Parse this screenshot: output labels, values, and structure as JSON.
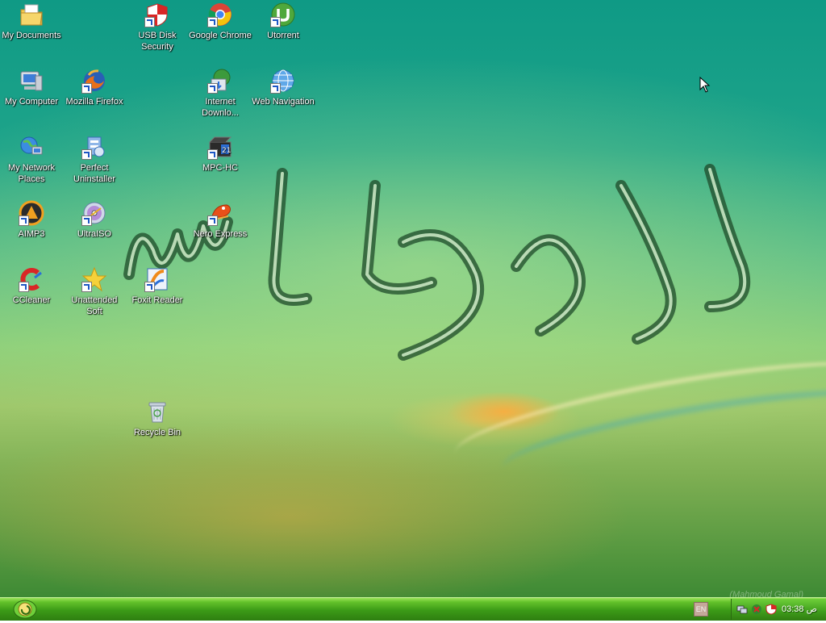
{
  "desktop_icons": [
    {
      "label": "My Documents",
      "icon": "my-documents-icon"
    },
    {
      "label": "My Computer",
      "icon": "my-computer-icon"
    },
    {
      "label": "My Network Places",
      "icon": "my-network-places-icon"
    },
    {
      "label": "AIMP3",
      "icon": "aimp3-icon"
    },
    {
      "label": "CCleaner",
      "icon": "ccleaner-icon"
    },
    {
      "label": "Mozilla Firefox",
      "icon": "firefox-icon"
    },
    {
      "label": "Perfect Uninstaller",
      "icon": "perfect-uninstaller-icon"
    },
    {
      "label": "UltraISO",
      "icon": "ultraiso-icon"
    },
    {
      "label": "Unattended Soft",
      "icon": "unattended-soft-icon"
    },
    {
      "label": "USB Disk Security",
      "icon": "usb-disk-security-icon"
    },
    {
      "label": "Foxit Reader",
      "icon": "foxit-reader-icon"
    },
    {
      "label": "Recycle Bin",
      "icon": "recycle-bin-icon"
    },
    {
      "label": "Google Chrome",
      "icon": "chrome-icon"
    },
    {
      "label": "Internet Downlo...",
      "icon": "internet-download-manager-icon"
    },
    {
      "label": "MPC-HC",
      "icon": "mpc-hc-icon"
    },
    {
      "label": "Nero Express",
      "icon": "nero-express-icon"
    },
    {
      "label": "Utorrent",
      "icon": "utorrent-icon"
    },
    {
      "label": "Web Navigation",
      "icon": "web-navigation-icon"
    }
  ],
  "wallpaper": {
    "watermark": "(Mahmoud Gamal)"
  },
  "taskbar": {
    "language": "EN",
    "clock": "03:38 ص"
  },
  "colors": {
    "taskbar_green": "#3b9a17",
    "desktop_teal": "#0f9a85"
  }
}
